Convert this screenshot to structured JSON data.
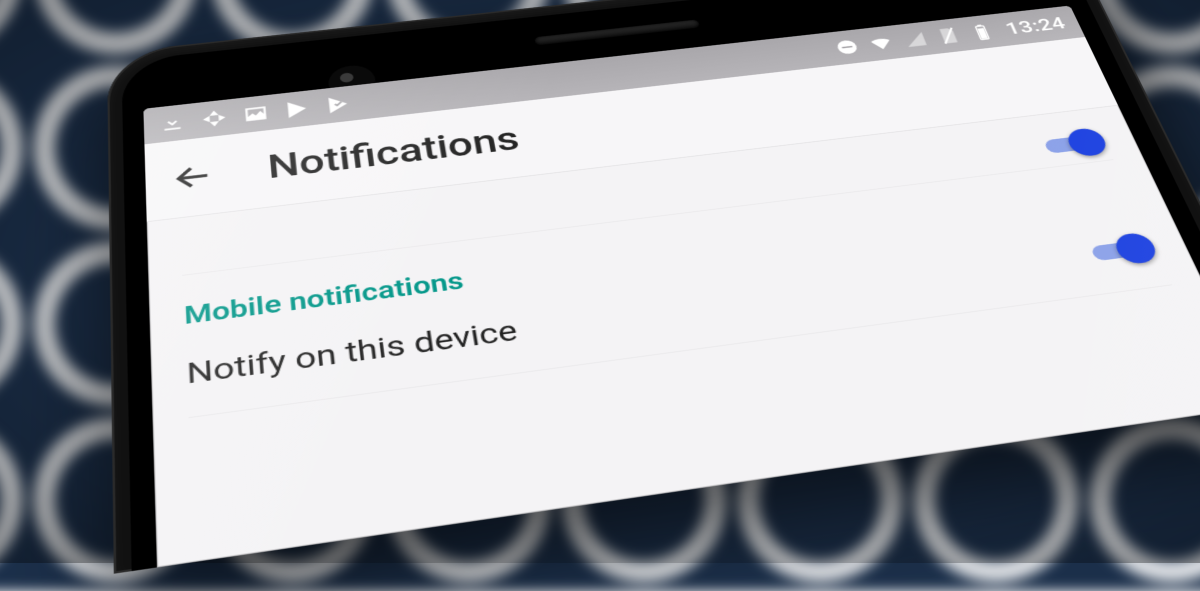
{
  "status_bar": {
    "time": "13:24",
    "left_icons": [
      "download-icon",
      "photos-pinwheel-icon",
      "picture-icon",
      "play-store-icon",
      "check-badge-icon"
    ],
    "right_icons": [
      "do-not-disturb-icon",
      "wifi-icon",
      "signal-icon",
      "sim-icon",
      "battery-icon"
    ]
  },
  "app_bar": {
    "title": "Notifications"
  },
  "rows": {
    "top_toggle_on": true,
    "section_header": "Mobile notifications",
    "notify_device_label": "Notify on this device",
    "notify_device_on": true
  },
  "colors": {
    "accent_teal": "#009688",
    "toggle_thumb": "#1a3fe0",
    "toggle_track": "#8aa0e8"
  }
}
